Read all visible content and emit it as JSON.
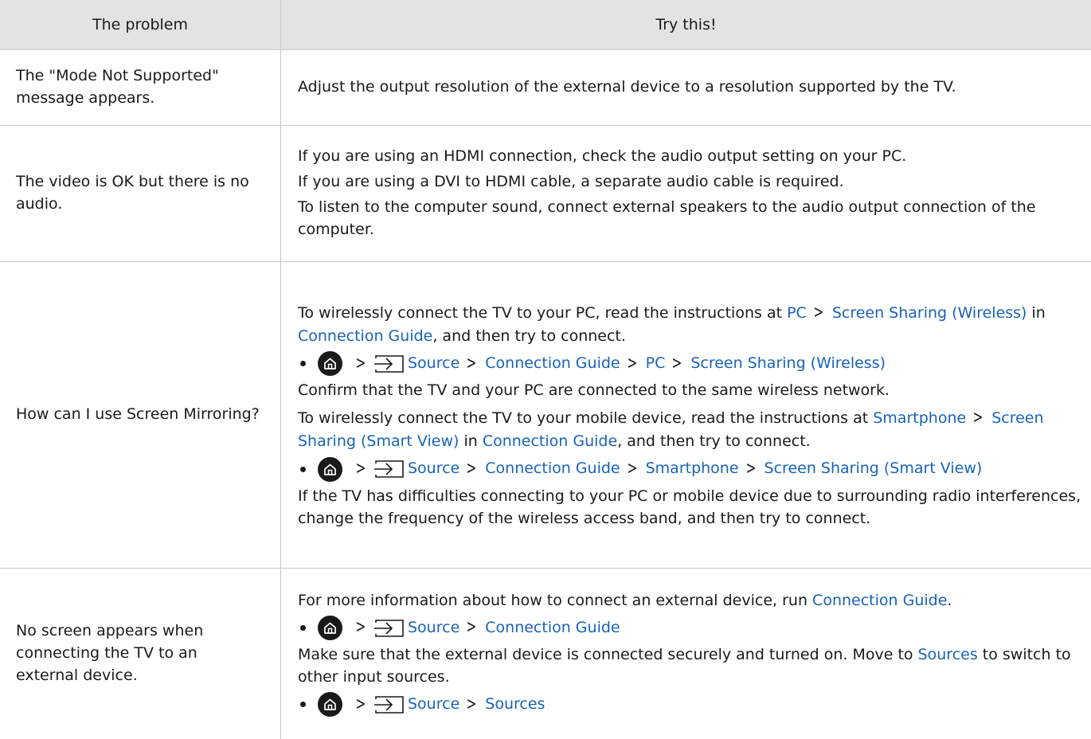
{
  "header": {
    "problem": "The problem",
    "solution": "Try this!"
  },
  "rows": [
    {
      "problem": "The \"Mode Not Supported\" message appears.",
      "p1": "Adjust the output resolution of the external device to a resolution supported by the TV."
    },
    {
      "problem": "The video is OK but there is no audio.",
      "p1": "If you are using an HDMI connection, check the audio output setting on your PC.",
      "p2": "If you are using a DVI to HDMI cable, a separate audio cable is required.",
      "p3": "To listen to the computer sound, connect external speakers to the audio output connection of the computer."
    },
    {
      "problem": "How can I use Screen Mirroring?",
      "p1_a": "To wirelessly connect the TV to your PC, read the instructions at ",
      "p1_link1": "PC",
      "p1_link2": "Screen Sharing (Wireless)",
      "p1_b": " in ",
      "p1_link3": "Connection Guide",
      "p1_c": ", and then try to connect.",
      "path1": [
        "Source",
        "Connection Guide",
        "PC",
        "Screen Sharing (Wireless)"
      ],
      "p2": "Confirm that the TV and your PC are connected to the same wireless network.",
      "p3_a": "To wirelessly connect the TV to your mobile device, read the instructions at ",
      "p3_link1": "Smartphone",
      "p3_link2": "Screen Sharing (Smart View)",
      "p3_b": " in ",
      "p3_link3": "Connection Guide",
      "p3_c": ", and then try to connect.",
      "path2": [
        "Source",
        "Connection Guide",
        "Smartphone",
        "Screen Sharing (Smart View)"
      ],
      "p4": "If the TV has difficulties connecting to your PC or mobile device due to surrounding radio interferences, change the frequency of the wireless access band, and then try to connect."
    },
    {
      "problem": "No screen appears when connecting the TV to an external device.",
      "p1_a": "For more information about how to connect an external device, run ",
      "p1_link": "Connection Guide",
      "p1_b": ".",
      "path1": [
        "Source",
        "Connection Guide"
      ],
      "p2_a": "Make sure that the external device is connected securely and turned on. Move to ",
      "p2_link": "Sources",
      "p2_b": " to switch to other input sources.",
      "path2": [
        "Source",
        "Sources"
      ]
    }
  ],
  "icons": {
    "home": "home-icon",
    "source": "source-icon",
    "separator": "chevron-right-icon"
  },
  "colors": {
    "link": "#1863b7",
    "header_bg": "#e3e3e3",
    "border": "#c9c9c9"
  }
}
